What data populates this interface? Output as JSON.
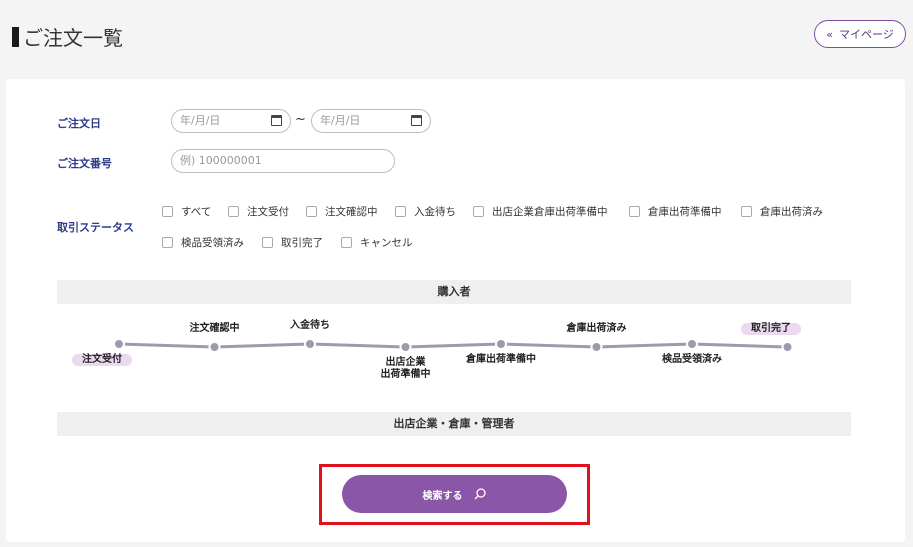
{
  "header": {
    "title": "ご注文一覧",
    "mypage_label": "マイページ",
    "mypage_chevron": "«"
  },
  "filters": {
    "order_date_label": "ご注文日",
    "date_from_placeholder": "年/月/日",
    "date_to_placeholder": "年/月/日",
    "date_separator": "~",
    "order_number_label": "ご注文番号",
    "order_number_placeholder": "例) 100000001",
    "status_label": "取引ステータス",
    "statuses": [
      "すべて",
      "注文受付",
      "注文確認中",
      "入金待ち",
      "出店企業倉庫出荷準備中",
      "倉庫出荷準備中",
      "倉庫出荷済み",
      "検品受領済み",
      "取引完了",
      "キャンセル"
    ]
  },
  "flow": {
    "buyer_section": "購入者",
    "staff_section": "出店企業・倉庫・管理者",
    "steps": [
      {
        "label": "注文受付",
        "position": "below",
        "highlight": true
      },
      {
        "label": "注文確認中",
        "position": "above",
        "highlight": false
      },
      {
        "label": "入金待ち",
        "position": "above",
        "highlight": false
      },
      {
        "label": "出店企業\n出荷準備中",
        "position": "below",
        "highlight": false
      },
      {
        "label": "倉庫出荷準備中",
        "position": "below",
        "highlight": false
      },
      {
        "label": "倉庫出荷済み",
        "position": "above",
        "highlight": false
      },
      {
        "label": "検品受領済み",
        "position": "below",
        "highlight": false
      },
      {
        "label": "取引完了",
        "position": "above",
        "highlight": true
      }
    ],
    "line_color": "#9a9cab",
    "highlight_color": "#ead9ef"
  },
  "search": {
    "button_label": "検索する",
    "button_color": "#8a56a8",
    "emphasis_color": "#e0111c"
  }
}
